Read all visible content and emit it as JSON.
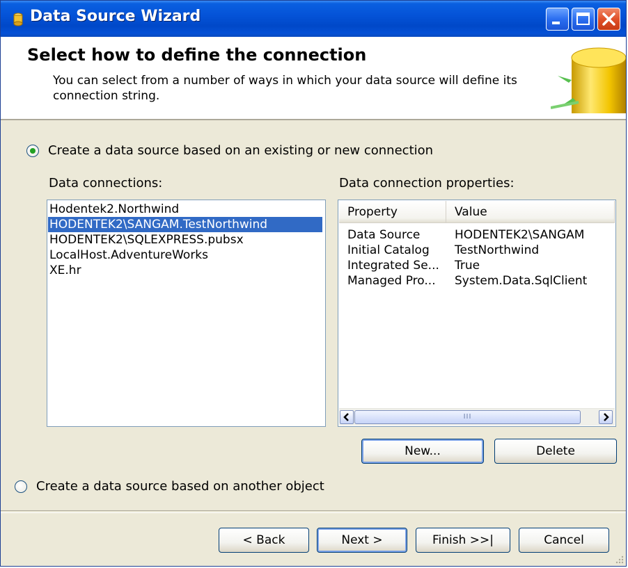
{
  "window": {
    "title": "Data Source Wizard",
    "controls": [
      "minimize-icon",
      "maximize-icon",
      "close-icon"
    ]
  },
  "header": {
    "title": "Select how to define the connection",
    "subtitle": "You can select from a number of ways in which your data source will define its connection string."
  },
  "options": {
    "existing_connection": {
      "label": "Create a data source based on an existing or new connection",
      "selected": true
    },
    "another_object": {
      "label": "Create a data source based on another object",
      "selected": false
    }
  },
  "connections": {
    "label": "Data connections:",
    "items": [
      "Hodentek2.Northwind",
      "HODENTEK2\\SANGAM.TestNorthwind",
      "HODENTEK2\\SQLEXPRESS.pubsx",
      "LocalHost.AdventureWorks",
      "XE.hr"
    ],
    "selected_index": 1
  },
  "properties": {
    "label": "Data connection properties:",
    "columns": [
      "Property",
      "Value"
    ],
    "rows": [
      [
        "Data Source",
        "HODENTEK2\\SANGAM"
      ],
      [
        "Initial Catalog",
        "TestNorthwind"
      ],
      [
        "Integrated Se...",
        "True"
      ],
      [
        "Managed Pro...",
        "System.Data.SqlClient"
      ]
    ],
    "scroll_thumb_glyph": "III"
  },
  "buttons": {
    "new": "New...",
    "delete": "Delete",
    "back": "< Back",
    "next": "Next >",
    "finish": "Finish >>|",
    "cancel": "Cancel"
  },
  "colors": {
    "titlebar": "#0453d8",
    "selection": "#316ac5",
    "dialog_bg": "#ece9d8"
  }
}
